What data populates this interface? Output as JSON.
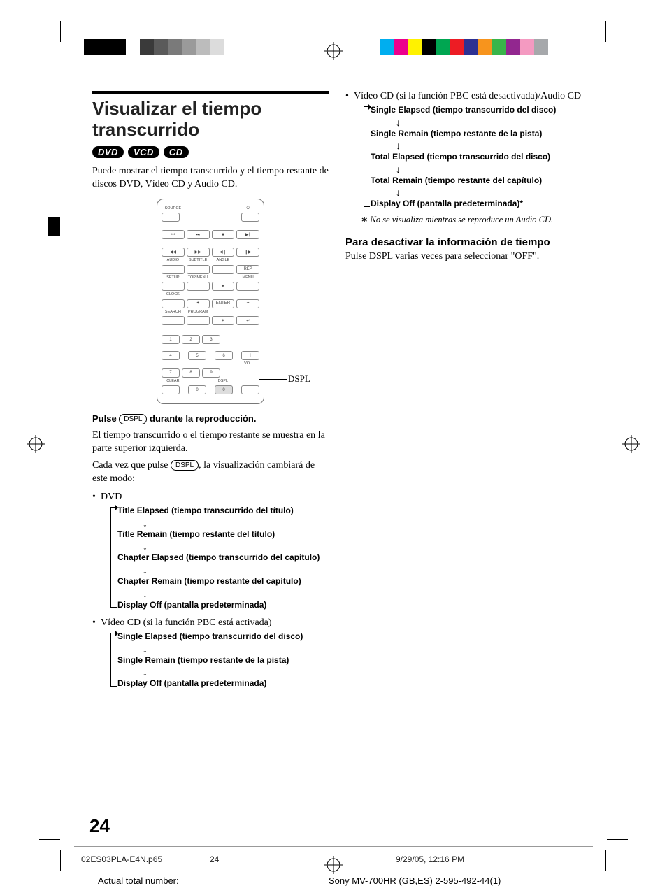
{
  "heading": "Visualizar el tiempo transcurrido",
  "badges": [
    "DVD",
    "VCD",
    "CD"
  ],
  "intro": "Puede mostrar el tiempo transcurrido y el tiempo restante de discos DVD, Vídeo CD y Audio CD.",
  "remote": {
    "source": "SOURCE",
    "power_icon": "⏻",
    "transport": {
      "prev": "⏮",
      "next": "⏭",
      "stop": "■",
      "playpause": "▶∥"
    },
    "row3": {
      "rew": "◀◀",
      "fwd": "▶▶",
      "stepb": "◀❙",
      "stepf": "❙▶"
    },
    "labels_row3": [
      "AUDIO",
      "SUBTITLE",
      "ANGLE",
      ""
    ],
    "row4_right": "REP",
    "labels_row4": [
      "SETUP",
      "TOP MENU",
      "",
      "MENU"
    ],
    "row5_center": "✦",
    "clock": "CLOCK",
    "row6": {
      "up": "✦",
      "enter": "ENTER",
      "right": "✦"
    },
    "labels_row6": [
      "SEARCH",
      "PROGRAM",
      "",
      ""
    ],
    "row7_center": "✦",
    "row7_right": "↩",
    "nums": [
      "1",
      "2",
      "3",
      "4",
      "5",
      "6",
      "7",
      "8",
      "9",
      "0"
    ],
    "plus": "＋",
    "minus": "－",
    "vol": "VOL",
    "clear": "CLEAR",
    "dspl_small": "DSPL",
    "zero_alt": "0"
  },
  "callout_label": "DSPL",
  "step_lead_a": "Pulse ",
  "dspl_pill": "DSPL",
  "step_lead_b": " durante la reproducción.",
  "step_body_1": "El tiempo transcurrido o el tiempo restante se muestra en la parte superior izquierda.",
  "step_body_2a": "Cada vez que pulse ",
  "step_body_2b": ", la visualización cambiará de este modo:",
  "lists": {
    "dvd": {
      "label": "DVD",
      "items": [
        "Title Elapsed (tiempo transcurrido del título)",
        "Title Remain (tiempo restante del título)",
        "Chapter Elapsed (tiempo transcurrido del capítulo)",
        "Chapter Remain (tiempo restante del capítulo)",
        "Display Off (pantalla predeterminada)"
      ]
    },
    "vcd_pbc_on": {
      "label": "Vídeo CD (si la función PBC está activada)",
      "items": [
        "Single Elapsed (tiempo transcurrido del disco)",
        "Single Remain (tiempo restante de la pista)",
        "Display Off (pantalla predeterminada)"
      ]
    },
    "vcd_pbc_off": {
      "label": "Vídeo CD (si la función PBC está desactivada)/Audio CD",
      "items": [
        "Single Elapsed (tiempo transcurrido del disco)",
        "Single Remain (tiempo restante de la pista)",
        "Total Elapsed (tiempo transcurrido del disco)",
        "Total Remain (tiempo restante del capítulo)",
        "Display Off (pantalla predeterminada)*"
      ]
    }
  },
  "footnote": "No se visualiza mientras  se reproduce un Audio CD.",
  "footnote_mark": "∗",
  "deactivate": {
    "heading": "Para desactivar la información de tiempo",
    "text_a": "Pulse ",
    "text_b": " varias veces para seleccionar \"OFF\"."
  },
  "page_number": "24",
  "footer": {
    "file": "02ES03PLA-E4N.p65",
    "page": "24",
    "datetime": "9/29/05, 12:16 PM"
  },
  "meta_left": "Actual total number:",
  "meta_right": "Sony MV-700HR (GB,ES) 2-595-492-44(1)",
  "colorbar_left": [
    "#000",
    "#333",
    "#555",
    "#777",
    "#999",
    "#bbb",
    "#ddd",
    "#000",
    "#000",
    "#000",
    "#000",
    "#000",
    "#000"
  ],
  "colorbar_right": [
    "#00aeef",
    "#ec008c",
    "#fff200",
    "#000",
    "#00a651",
    "#ed1c24",
    "#2e3192",
    "#f7941d",
    "#39b54a",
    "#92278f",
    "#f49ac1",
    "#a6a8ab"
  ]
}
